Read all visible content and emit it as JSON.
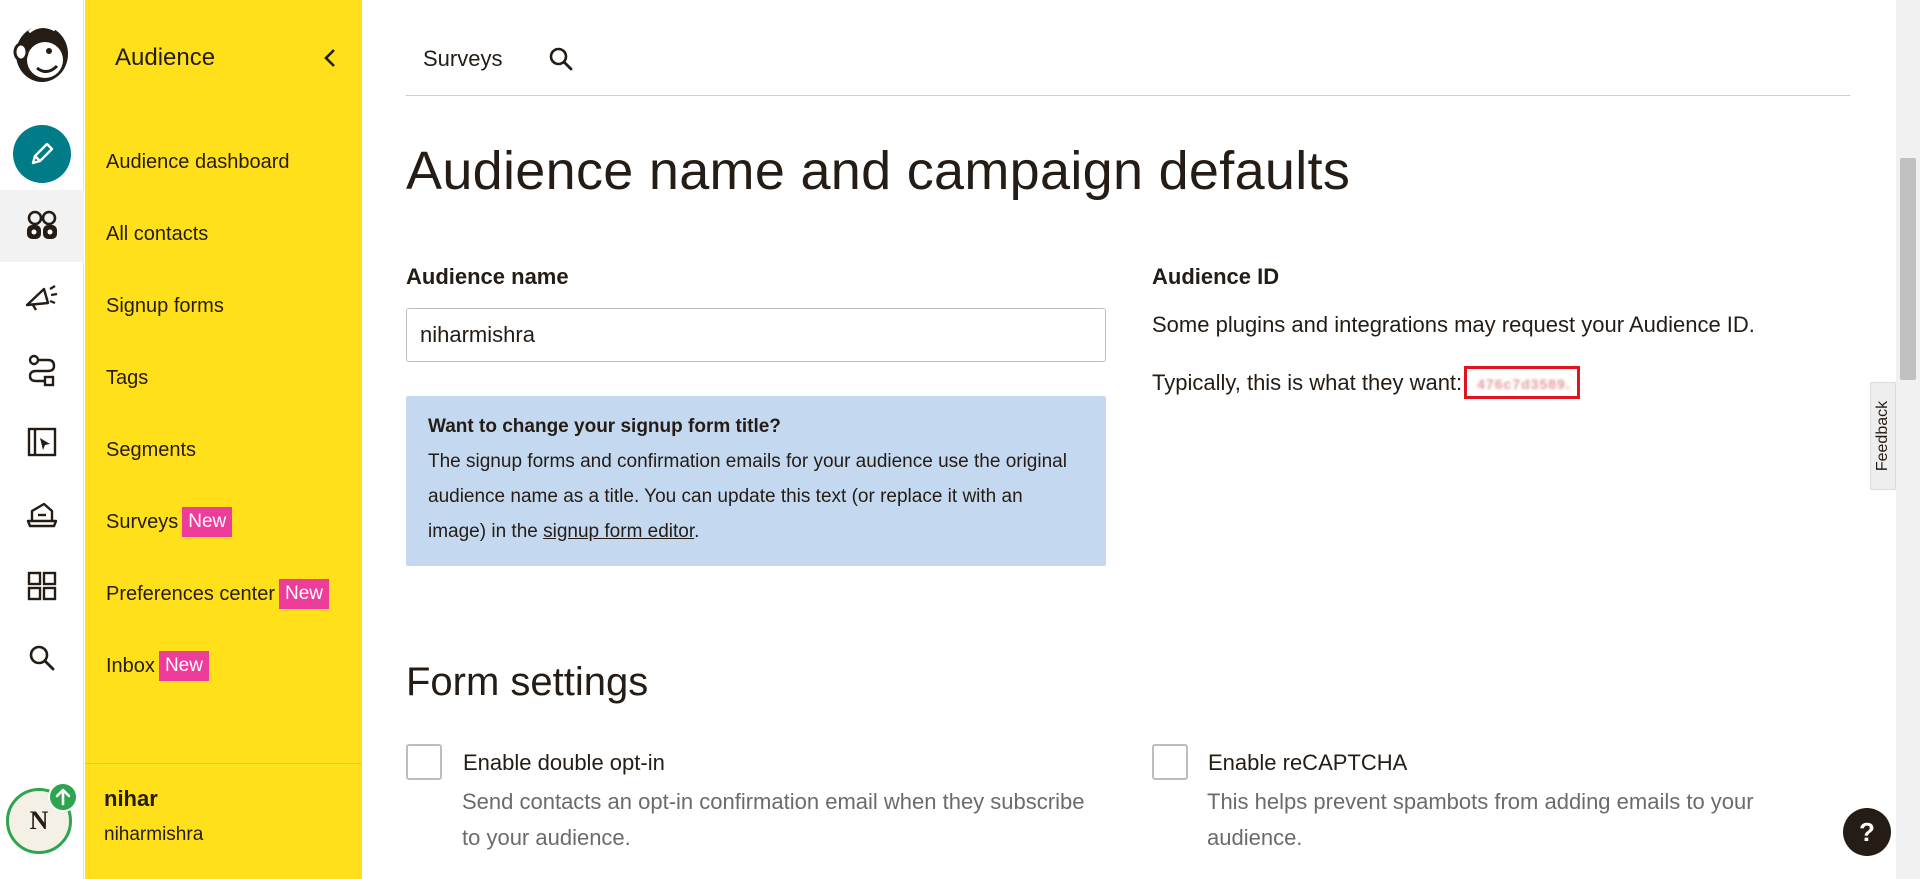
{
  "rail": {
    "items": [
      {
        "icon": "mailchimp-logo-icon"
      },
      {
        "icon": "pencil-icon",
        "label": "Create"
      },
      {
        "icon": "audience-icon",
        "label": "Audience"
      },
      {
        "icon": "megaphone-icon",
        "label": "Campaigns"
      },
      {
        "icon": "automations-icon",
        "label": "Automations"
      },
      {
        "icon": "website-icon",
        "label": "Website"
      },
      {
        "icon": "content-icon",
        "label": "Content"
      },
      {
        "icon": "integrations-icon",
        "label": "Integrations"
      },
      {
        "icon": "search-icon",
        "label": "Search"
      }
    ],
    "avatar_initial": "N",
    "colors": {
      "create": "#007c89",
      "badge": "#2ea44f"
    }
  },
  "nav": {
    "title": "Audience",
    "items": [
      {
        "label": "Audience dashboard"
      },
      {
        "label": "All contacts"
      },
      {
        "label": "Signup forms"
      },
      {
        "label": "Tags"
      },
      {
        "label": "Segments"
      },
      {
        "label": "Surveys",
        "badge": "New"
      },
      {
        "label": "Preferences center",
        "badge": "New"
      },
      {
        "label": "Inbox",
        "badge": "New"
      }
    ],
    "user": {
      "name": "nihar",
      "account": "niharmishra"
    },
    "colors": {
      "background": "#ffe01b",
      "badge": "#ee3c9b"
    }
  },
  "topbar": {
    "link": "Surveys",
    "search_icon": "search-icon"
  },
  "page": {
    "title": "Audience name and campaign defaults",
    "audience_name": {
      "label": "Audience name",
      "value": "niharmishra"
    },
    "info": {
      "title": "Want to change your signup form title?",
      "body": "The signup forms and confirmation emails for your audience use the original audience name as a title. You can update this text (or replace it with an image) in the ",
      "link": "signup form editor",
      "end": "."
    },
    "audience_id": {
      "label": "Audience ID",
      "help": "Some plugins and integrations may request your Audience ID.",
      "typical": "Typically, this is what they want:",
      "value": "476c7d3589."
    },
    "form_settings": {
      "title": "Form settings",
      "double_optin": {
        "label": "Enable double opt-in",
        "help": "Send contacts an opt-in confirmation email when they subscribe to your audience."
      },
      "recaptcha": {
        "label": "Enable reCAPTCHA",
        "help": "This helps prevent spambots from adding emails to your audience."
      }
    }
  },
  "feedback": "Feedback",
  "help_button": "?"
}
